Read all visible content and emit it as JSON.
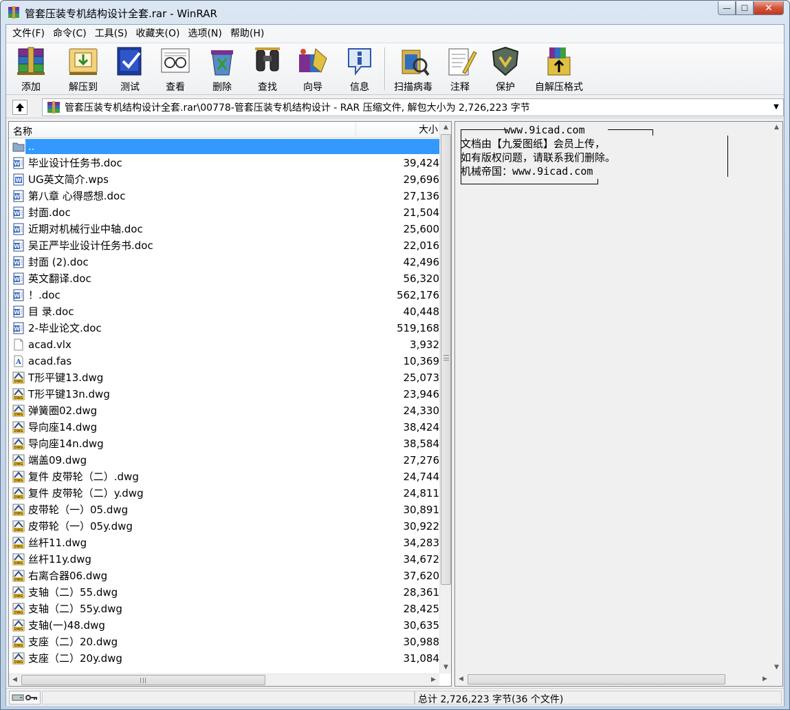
{
  "window": {
    "title": "管套压装专机结构设计全套.rar - WinRAR",
    "buttons": {
      "minimize": "—",
      "maximize": "☐",
      "close": "✕"
    }
  },
  "menu": [
    "文件(F)",
    "命令(C)",
    "工具(S)",
    "收藏夹(O)",
    "选项(N)",
    "帮助(H)"
  ],
  "toolbar": [
    {
      "label": "添加",
      "icon": "add-archive-icon"
    },
    {
      "label": "解压到",
      "icon": "extract-to-icon"
    },
    {
      "label": "测试",
      "icon": "test-icon"
    },
    {
      "label": "查看",
      "icon": "view-icon"
    },
    {
      "label": "删除",
      "icon": "delete-icon"
    },
    {
      "label": "查找",
      "icon": "find-icon"
    },
    {
      "label": "向导",
      "icon": "wizard-icon"
    },
    {
      "label": "信息",
      "icon": "info-icon"
    },
    {
      "label": "扫描病毒",
      "icon": "virus-scan-icon"
    },
    {
      "label": "注释",
      "icon": "comment-icon"
    },
    {
      "label": "保护",
      "icon": "protect-icon"
    },
    {
      "label": "自解压格式",
      "icon": "sfx-icon"
    }
  ],
  "path": {
    "text": "管套压装专机结构设计全套.rar\\00778-管套压装专机结构设计 - RAR 压缩文件, 解包大小为 2,726,223 字节"
  },
  "list": {
    "col_name": "名称",
    "col_size": "大小",
    "rows": [
      {
        "name": "..",
        "size": "",
        "type": "folder"
      },
      {
        "name": "毕业设计任务书.doc",
        "size": "39,424",
        "type": "doc"
      },
      {
        "name": "UG英文简介.wps",
        "size": "29,696",
        "type": "wps"
      },
      {
        "name": "第八章 心得感想.doc",
        "size": "27,136",
        "type": "doc"
      },
      {
        "name": "封面.doc",
        "size": "21,504",
        "type": "doc"
      },
      {
        "name": "近期对机械行业中轴.doc",
        "size": "25,600",
        "type": "doc"
      },
      {
        "name": "吴正严毕业设计任务书.doc",
        "size": "22,016",
        "type": "doc"
      },
      {
        "name": "封面 (2).doc",
        "size": "42,496",
        "type": "doc"
      },
      {
        "name": "英文翻译.doc",
        "size": "56,320",
        "type": "doc"
      },
      {
        "name": "！.doc",
        "size": "562,176",
        "type": "doc"
      },
      {
        "name": "目  录.doc",
        "size": "40,448",
        "type": "doc"
      },
      {
        "name": "2-毕业论文.doc",
        "size": "519,168",
        "type": "doc"
      },
      {
        "name": "acad.vlx",
        "size": "3,932",
        "type": "blank"
      },
      {
        "name": "acad.fas",
        "size": "10,369",
        "type": "fas"
      },
      {
        "name": "T形平键13.dwg",
        "size": "25,073",
        "type": "dwg"
      },
      {
        "name": "T形平键13n.dwg",
        "size": "23,946",
        "type": "dwg"
      },
      {
        "name": "弹簧圈02.dwg",
        "size": "24,330",
        "type": "dwg"
      },
      {
        "name": "导向座14.dwg",
        "size": "38,424",
        "type": "dwg"
      },
      {
        "name": "导向座14n.dwg",
        "size": "38,584",
        "type": "dwg"
      },
      {
        "name": "端盖09.dwg",
        "size": "27,276",
        "type": "dwg"
      },
      {
        "name": "复件 皮带轮（二）.dwg",
        "size": "24,744",
        "type": "dwg"
      },
      {
        "name": "复件 皮带轮（二）y.dwg",
        "size": "24,811",
        "type": "dwg"
      },
      {
        "name": "皮带轮（一）05.dwg",
        "size": "30,891",
        "type": "dwg"
      },
      {
        "name": "皮带轮（一）05y.dwg",
        "size": "30,922",
        "type": "dwg"
      },
      {
        "name": "丝杆11.dwg",
        "size": "34,283",
        "type": "dwg"
      },
      {
        "name": "丝杆11y.dwg",
        "size": "34,672",
        "type": "dwg"
      },
      {
        "name": "右离合器06.dwg",
        "size": "37,620",
        "type": "dwg"
      },
      {
        "name": "支轴（二）55.dwg",
        "size": "28,361",
        "type": "dwg"
      },
      {
        "name": "支轴（二）55y.dwg",
        "size": "28,425",
        "type": "dwg"
      },
      {
        "name": "支轴(一)48.dwg",
        "size": "30,635",
        "type": "dwg"
      },
      {
        "name": "支座（二）20.dwg",
        "size": "30,988",
        "type": "dwg"
      },
      {
        "name": "支座（二）20y.dwg",
        "size": "31,084",
        "type": "dwg"
      }
    ]
  },
  "comment": {
    "lines": [
      "       www.9icad.com",
      "文档由【九爱图纸】会员上传，",
      "如有版权问题，请联系我们删除。",
      "机械帝国：www.9icad.com"
    ]
  },
  "status": {
    "left": "",
    "right": "总计 2,726,223 字节(36 个文件)"
  },
  "colors": {
    "selection": "#3399ff",
    "window_frame": "#c8d8ea",
    "close_button": "#c0391f"
  }
}
